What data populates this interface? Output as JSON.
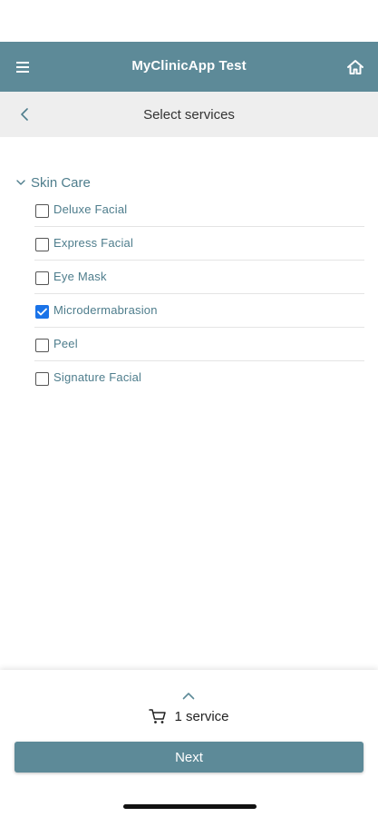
{
  "header": {
    "title": "MyClinicApp Test",
    "menu_icon": "hamburger-menu-icon",
    "home_icon": "home-icon"
  },
  "subheader": {
    "title": "Select services",
    "back_icon": "chevron-left-icon"
  },
  "category": {
    "name": "Skin Care",
    "expanded": true,
    "icon": "chevron-down-icon"
  },
  "services": [
    {
      "label": "Deluxe Facial",
      "checked": false
    },
    {
      "label": "Express Facial",
      "checked": false
    },
    {
      "label": "Eye Mask",
      "checked": false
    },
    {
      "label": "Microdermabrasion",
      "checked": true
    },
    {
      "label": "Peel",
      "checked": false
    },
    {
      "label": "Signature Facial",
      "checked": false
    }
  ],
  "footer": {
    "expand_icon": "chevron-up-icon",
    "cart_icon": "cart-icon",
    "cart_text": "1 service",
    "next_label": "Next"
  },
  "colors": {
    "primary": "#5d8a98",
    "accent_text": "#4e7d8c",
    "checkbox_checked": "#1a73e8",
    "subheader_bg": "#eeeeee"
  }
}
